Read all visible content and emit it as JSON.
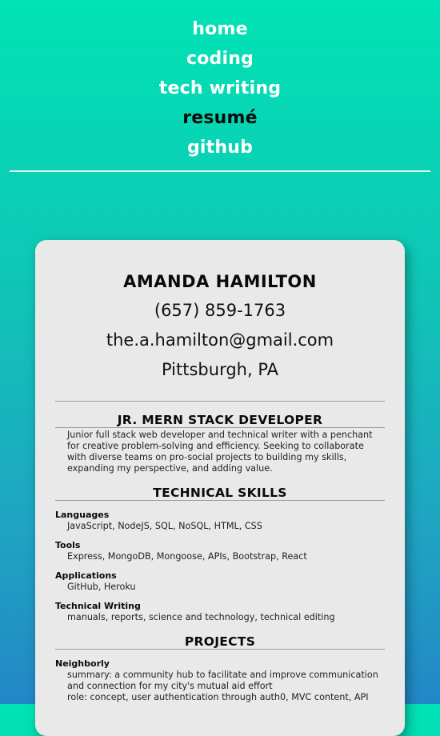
{
  "nav": {
    "items": [
      {
        "label": "home"
      },
      {
        "label": "coding"
      },
      {
        "label": "tech writing"
      },
      {
        "label": "resumé"
      },
      {
        "label": "github"
      }
    ]
  },
  "resume": {
    "name": "AMANDA HAMILTON",
    "phone": "(657) 859-1763",
    "email": "the.a.hamilton@gmail.com",
    "location": "Pittsburgh, PA",
    "title": "JR. MERN STACK DEVELOPER",
    "summary": "Junior full stack web developer and technical writer with a penchant for creative problem-solving and efficiency. Seeking to collaborate with diverse teams on pro-social projects to building my skills, expanding my perspective, and adding value.",
    "skills_heading": "TECHNICAL SKILLS",
    "skills": [
      {
        "label": "Languages",
        "value": "JavaScript, NodeJS, SQL, NoSQL, HTML, CSS"
      },
      {
        "label": "Tools",
        "value": "Express, MongoDB, Mongoose, APIs, Bootstrap, React"
      },
      {
        "label": "Applications",
        "value": "GitHub, Heroku"
      },
      {
        "label": "Technical Writing",
        "value": "manuals, reports, science and technology, technical editing"
      }
    ],
    "projects_heading": "PROJECTS",
    "projects": [
      {
        "name": "Neighborly",
        "summary": "summary: a community hub to facilitate and improve communication and connection for my city's mutual aid effort",
        "role": "role: concept, user authentication through auth0, MVC content, API"
      }
    ]
  }
}
